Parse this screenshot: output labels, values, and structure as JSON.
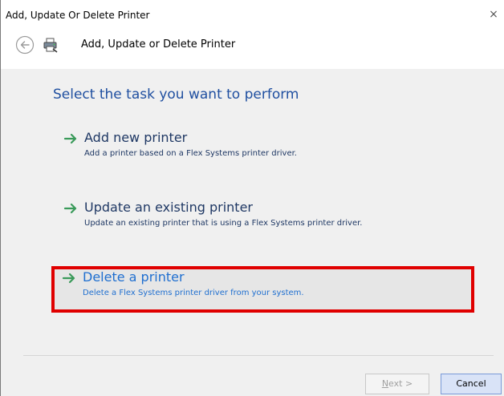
{
  "window": {
    "title": "Add, Update Or Delete Printer",
    "close_glyph": "×"
  },
  "header": {
    "title": "Add,  Update or Delete Printer",
    "back_icon": "back-arrow-icon",
    "printer_icon": "printer-icon"
  },
  "content": {
    "instruction": "Select the task you want to perform",
    "options": [
      {
        "title": "Add new printer",
        "description": "Add a printer based on a Flex Systems printer driver.",
        "highlighted": false
      },
      {
        "title": "Update an existing printer",
        "description": "Update an existing printer that is using a Flex Systems printer driver.",
        "highlighted": false
      },
      {
        "title": "Delete a printer",
        "description": "Delete a Flex Systems printer driver from your system.",
        "highlighted": true
      }
    ]
  },
  "footer": {
    "next_label_mnemonic": "N",
    "next_label_rest": "ext >",
    "cancel_label": "Cancel"
  },
  "colors": {
    "arrow_green": "#3a9a5a",
    "highlight_border": "#e00000",
    "link_blue": "#1f6fd0"
  }
}
